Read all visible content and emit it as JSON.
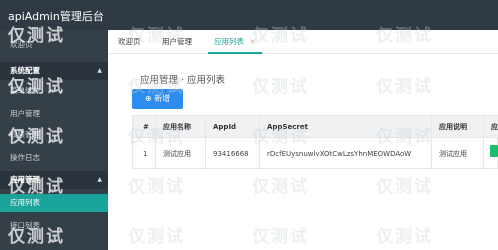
{
  "app": {
    "title": "apiAdmin管理后台"
  },
  "sidebar": {
    "items": [
      {
        "label": "欢迎页",
        "type": "item"
      },
      {
        "label": "系统配置",
        "type": "group"
      },
      {
        "label": "菜单维护",
        "type": "item"
      },
      {
        "label": "用户管理",
        "type": "item"
      },
      {
        "label": "权限管理",
        "type": "item"
      },
      {
        "label": "操作日志",
        "type": "item"
      },
      {
        "label": "应用管理",
        "type": "group"
      },
      {
        "label": "应用列表",
        "type": "active"
      },
      {
        "label": "接口列表",
        "type": "item"
      }
    ]
  },
  "tabs": [
    {
      "label": "欢迎页"
    },
    {
      "label": "用户管理"
    },
    {
      "label": "应用列表",
      "close": "×"
    }
  ],
  "breadcrumb": "应用管理 · 应用列表",
  "toolbar": {
    "add_icon": "⊕",
    "add_label": "新增"
  },
  "table": {
    "headers": [
      "#",
      "应用名称",
      "AppId",
      "AppSecret",
      "应用说明",
      "应"
    ],
    "rows": [
      [
        "1",
        "测试应用",
        "93416668",
        "rDcfEUysnuwlvXOtCwLzsYhnMEOWDAoW",
        "测试应用",
        ""
      ]
    ]
  },
  "watermark": {
    "text": "仅测试"
  },
  "colors": {
    "accent": "#1aa39a",
    "button": "#2d8cf0",
    "sidebar": "#353f48",
    "topbar": "#2f3a44"
  }
}
